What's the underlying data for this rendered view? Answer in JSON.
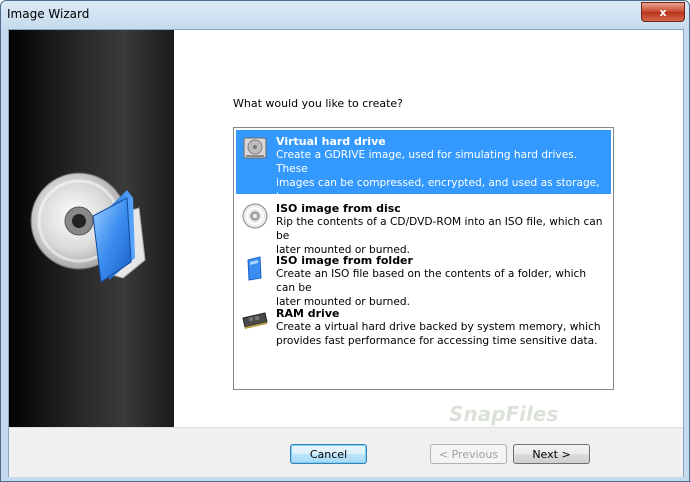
{
  "window": {
    "title": "Image Wizard",
    "close_glyph": "x"
  },
  "prompt": "What would you like to create?",
  "options": [
    {
      "title": "Virtual hard drive",
      "desc": [
        "Create a GDRIVE image, used for simulating hard drives. These",
        "images can be compressed, encrypted, and used as storage, to",
        "protect your secretive files from malicious users."
      ],
      "icon": "hard-drive-icon",
      "selected": true
    },
    {
      "title": "ISO image from disc",
      "desc": [
        "Rip the contents of a CD/DVD-ROM into an ISO file, which can be",
        "later mounted or burned."
      ],
      "icon": "disc-icon",
      "selected": false
    },
    {
      "title": "ISO image from folder",
      "desc": [
        "Create an ISO file based on the contents of a folder, which can be",
        "later mounted or burned."
      ],
      "icon": "folder-icon",
      "selected": false
    },
    {
      "title": "RAM drive",
      "desc": [
        "Create a virtual hard drive backed by system memory, which",
        "provides fast performance for accessing time sensitive data."
      ],
      "icon": "ram-chip-icon",
      "selected": false
    }
  ],
  "buttons": {
    "cancel": "Cancel",
    "previous": "< Previous",
    "next": "Next >"
  },
  "watermark": "SnapFiles",
  "colors": {
    "selection": "#3399ff",
    "close": "#c9462c"
  }
}
